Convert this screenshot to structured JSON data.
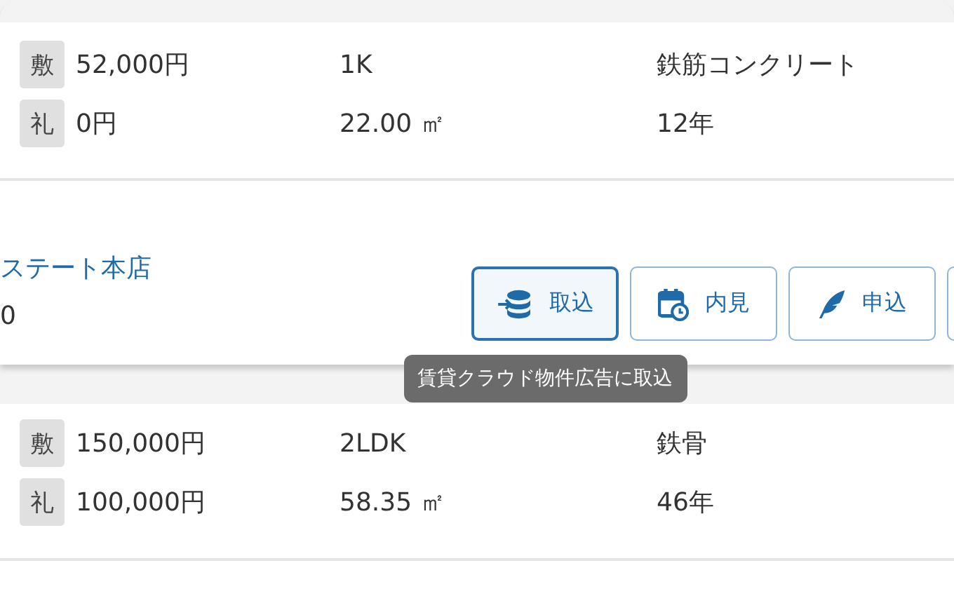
{
  "listings": [
    {
      "deposit_label": "敷",
      "deposit": "52,000円",
      "key_money_label": "礼",
      "key_money": "0円",
      "layout": "1K",
      "area": "22.00 ㎡",
      "structure": "鉄筋コンクリート",
      "age": "12年"
    },
    {
      "deposit_label": "敷",
      "deposit": "150,000円",
      "key_money_label": "礼",
      "key_money": "100,000円",
      "layout": "2LDK",
      "area": "58.35 ㎡",
      "structure": "鉄骨",
      "age": "46年"
    }
  ],
  "agency": {
    "name": "ステート本店",
    "line_2": "0"
  },
  "actions": [
    {
      "kind": "import",
      "label": "取込",
      "selected": true,
      "tooltip": "賃貸クラウド物件広告に取込"
    },
    {
      "kind": "viewing",
      "label": "内見",
      "selected": false
    },
    {
      "kind": "apply",
      "label": "申込",
      "selected": false
    },
    {
      "kind": "cut",
      "selected": false
    }
  ]
}
